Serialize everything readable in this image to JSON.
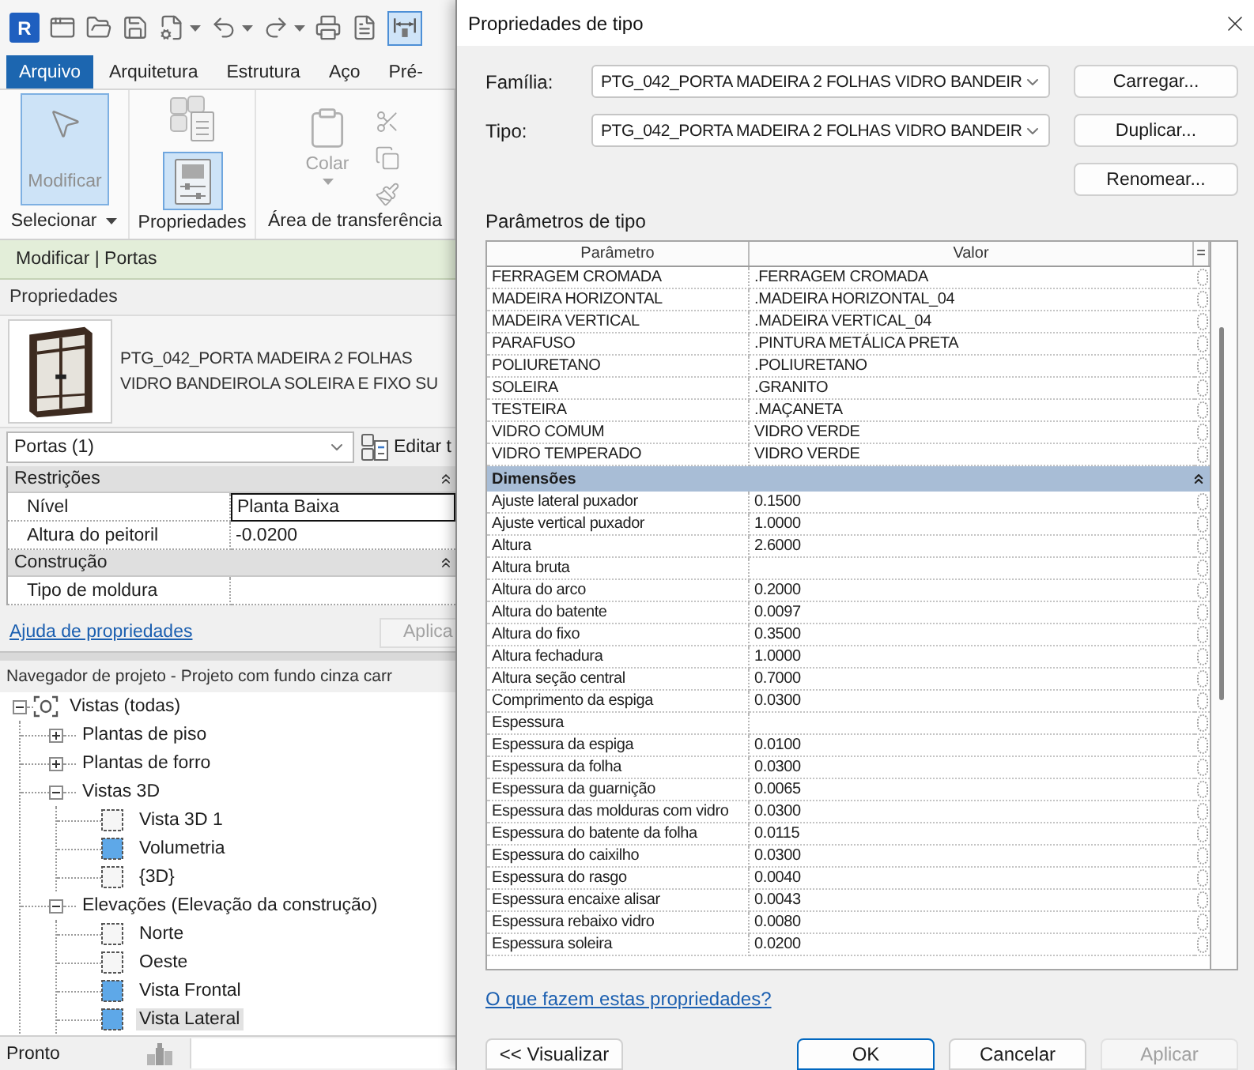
{
  "quick_access_toolbar": {
    "logo": "R",
    "last_tool_selected": true
  },
  "ribbon": {
    "tabs": [
      {
        "label": "Arquivo",
        "selected": true
      },
      {
        "label": "Arquitetura",
        "selected": false
      },
      {
        "label": "Estrutura",
        "selected": false
      },
      {
        "label": "Aço",
        "selected": false
      },
      {
        "label": "Pré-",
        "selected": false
      }
    ],
    "panels": [
      {
        "kind": "select",
        "label": "Selecionar",
        "dropdown": true,
        "button": {
          "label": "Modificar",
          "selected": true
        }
      },
      {
        "kind": "properties",
        "label": "Propriedades",
        "dropdown": false,
        "button": {
          "selected": true
        }
      },
      {
        "kind": "clipboard",
        "label": "Área de transferência",
        "dropdown": false,
        "button": {
          "label": "Colar",
          "disabled": true
        }
      }
    ]
  },
  "options_bar": {
    "label": "Modificar | Portas"
  },
  "properties_palette": {
    "title": "Propriedades",
    "type_name": "PTG_042_PORTA MADEIRA 2 FOLHAS VIDRO BANDEIROLA SOLEIRA E FIXO SU",
    "selector": {
      "value": "Portas (1)"
    },
    "edit_type_button": "Editar t",
    "groups": [
      {
        "name": "Restrições",
        "expanded": true,
        "rows": [
          {
            "name": "Nível",
            "value": "Planta Baixa",
            "editing": true
          },
          {
            "name": "Altura do peitoril",
            "value": "-0.0200",
            "editing": false
          }
        ]
      },
      {
        "name": "Construção",
        "expanded": true,
        "rows": [
          {
            "name": "Tipo de moldura",
            "editing": false
          }
        ]
      }
    ],
    "help_link": "Ajuda de propriedades",
    "apply_button": {
      "label": "Aplica",
      "disabled": true
    }
  },
  "project_browser": {
    "title": "Navegador de projeto - Projeto com fundo cinza carr",
    "tree": [
      {
        "kind": "root",
        "label": "Vistas (todas)",
        "expanded": true,
        "selected": false,
        "children": [
          {
            "kind": "group",
            "label": "Plantas de piso",
            "expanded": false,
            "selected": false
          },
          {
            "kind": "group",
            "label": "Plantas de forro",
            "expanded": false,
            "selected": false
          },
          {
            "kind": "group",
            "label": "Vistas 3D",
            "expanded": true,
            "selected": false,
            "children": [
              {
                "kind": "view",
                "label": "Vista 3D 1",
                "filled": false,
                "selected": false
              },
              {
                "kind": "view",
                "label": "Volumetria",
                "filled": true,
                "selected": false
              },
              {
                "kind": "view",
                "label": "{3D}",
                "filled": false,
                "selected": false
              }
            ]
          },
          {
            "kind": "group",
            "label": "Elevações (Elevação da construção)",
            "expanded": true,
            "selected": false,
            "children": [
              {
                "kind": "view",
                "label": "Norte",
                "filled": false,
                "selected": false
              },
              {
                "kind": "view",
                "label": "Oeste",
                "filled": false,
                "selected": false
              },
              {
                "kind": "view",
                "label": "Vista Frontal",
                "filled": true,
                "selected": false
              },
              {
                "kind": "view",
                "label": "Vista Lateral",
                "filled": true,
                "selected": true
              }
            ]
          }
        ]
      }
    ]
  },
  "status_bar": {
    "text": "Pronto"
  },
  "dialog": {
    "title": "Propriedades de tipo",
    "fields": [
      {
        "label": "Família:",
        "value": "PTG_042_PORTA MADEIRA 2 FOLHAS VIDRO BANDEIR"
      },
      {
        "label": "Tipo:",
        "value": "PTG_042_PORTA MADEIRA 2 FOLHAS VIDRO BANDEIR"
      }
    ],
    "side_buttons": [
      "Carregar...",
      "Duplicar...",
      "Renomear..."
    ],
    "section_label": "Parâmetros de tipo",
    "table": {
      "columns": [
        "Parâmetro",
        "Valor",
        "="
      ],
      "rows": [
        {
          "kind": "param",
          "name": "FERRAGEM CROMADA",
          "value": ".FERRAGEM CROMADA"
        },
        {
          "kind": "param",
          "name": "MADEIRA HORIZONTAL",
          "value": ".MADEIRA HORIZONTAL_04"
        },
        {
          "kind": "param",
          "name": "MADEIRA VERTICAL",
          "value": ".MADEIRA VERTICAL_04"
        },
        {
          "kind": "param",
          "name": "PARAFUSO",
          "value": ".PINTURA METÁLICA PRETA"
        },
        {
          "kind": "param",
          "name": "POLIURETANO",
          "value": ".POLIURETANO"
        },
        {
          "kind": "param",
          "name": "SOLEIRA",
          "value": ".GRANITO"
        },
        {
          "kind": "param",
          "name": "TESTEIRA",
          "value": ".MAÇANETA"
        },
        {
          "kind": "param",
          "name": "VIDRO COMUM",
          "value": "VIDRO VERDE"
        },
        {
          "kind": "param",
          "name": "VIDRO TEMPERADO",
          "value": "VIDRO VERDE"
        },
        {
          "kind": "group",
          "label": "Dimensões",
          "expanded": true
        },
        {
          "kind": "param",
          "name": "Ajuste lateral puxador",
          "value": "0.1500"
        },
        {
          "kind": "param",
          "name": "Ajuste vertical puxador",
          "value": "1.0000"
        },
        {
          "kind": "param",
          "name": "Altura",
          "value": "2.6000"
        },
        {
          "kind": "param",
          "name": "Altura bruta"
        },
        {
          "kind": "param",
          "name": "Altura do arco",
          "value": "0.2000"
        },
        {
          "kind": "param",
          "name": "Altura do batente",
          "value": "0.0097"
        },
        {
          "kind": "param",
          "name": "Altura do fixo",
          "value": "0.3500"
        },
        {
          "kind": "param",
          "name": "Altura fechadura",
          "value": "1.0000"
        },
        {
          "kind": "param",
          "name": "Altura seção central",
          "value": "0.7000"
        },
        {
          "kind": "param",
          "name": "Comprimento da espiga",
          "value": "0.0300"
        },
        {
          "kind": "param",
          "name": "Espessura"
        },
        {
          "kind": "param",
          "name": "Espessura da espiga",
          "value": "0.0100"
        },
        {
          "kind": "param",
          "name": "Espessura da folha",
          "value": "0.0300"
        },
        {
          "kind": "param",
          "name": "Espessura da guarnição",
          "value": "0.0065"
        },
        {
          "kind": "param",
          "name": "Espessura das molduras com vidro",
          "value": "0.0300"
        },
        {
          "kind": "param",
          "name": "Espessura do batente da folha",
          "value": "0.0115"
        },
        {
          "kind": "param",
          "name": "Espessura do caixilho",
          "value": "0.0300"
        },
        {
          "kind": "param",
          "name": "Espessura do rasgo",
          "value": "0.0040"
        },
        {
          "kind": "param",
          "name": "Espessura encaixe alisar",
          "value": "0.0043"
        },
        {
          "kind": "param",
          "name": "Espessura rebaixo vidro",
          "value": "0.0080"
        },
        {
          "kind": "param",
          "name": "Espessura soleira",
          "value": "0.0200"
        }
      ]
    },
    "help_link": "O que fazem estas propriedades?",
    "buttons": [
      {
        "label": "<< Visualizar",
        "default": false,
        "disabled": false
      },
      {
        "label": "OK",
        "default": true,
        "disabled": false
      },
      {
        "label": "Cancelar",
        "default": false,
        "disabled": false
      },
      {
        "label": "Aplicar",
        "default": false,
        "disabled": true
      }
    ]
  }
}
